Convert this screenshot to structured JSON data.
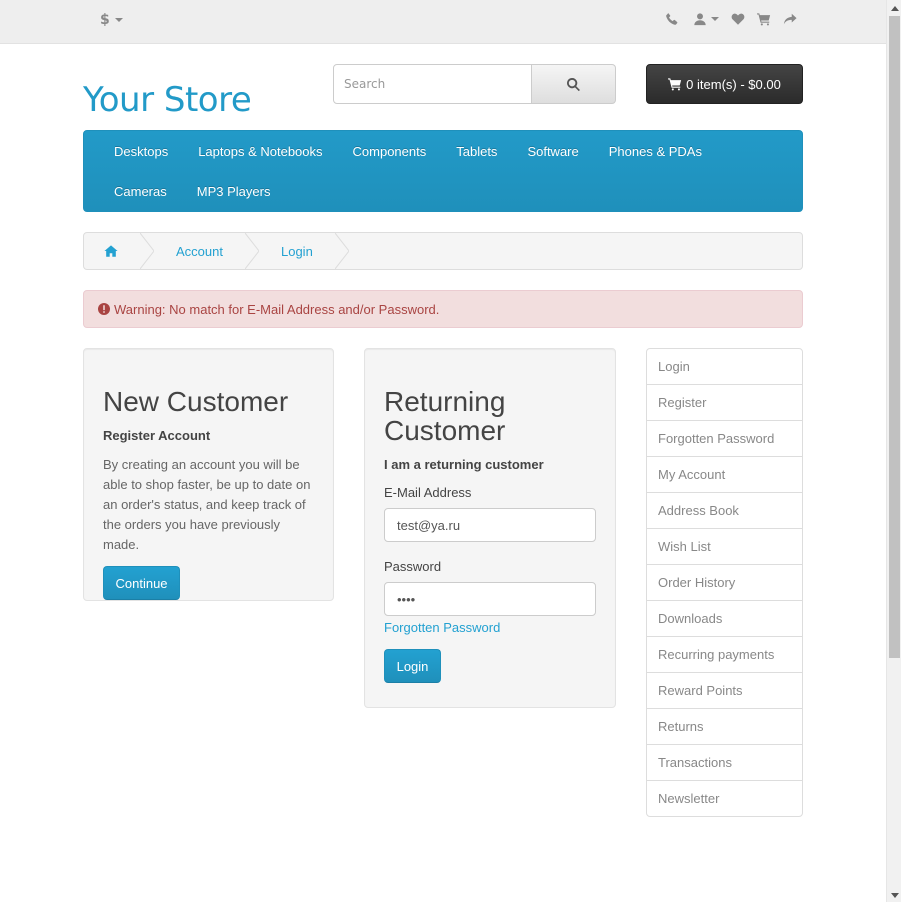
{
  "topbar": {
    "currency_symbol": "$",
    "icons": [
      "phone-icon",
      "user-icon",
      "heart-icon",
      "cart-icon",
      "share-icon"
    ]
  },
  "header": {
    "logo_text": "Your Store",
    "search_placeholder": "Search",
    "cart_label": "0 item(s) - $0.00"
  },
  "menu": {
    "items": [
      "Desktops",
      "Laptops & Notebooks",
      "Components",
      "Tablets",
      "Software",
      "Phones & PDAs",
      "Cameras",
      "MP3 Players"
    ]
  },
  "breadcrumb": {
    "items": [
      "Account",
      "Login"
    ]
  },
  "alert": {
    "text": "Warning: No match for E-Mail Address and/or Password."
  },
  "new_customer": {
    "title": "New Customer",
    "subtitle": "Register Account",
    "description": "By creating an account you will be able to shop faster, be up to date on an order's status, and keep track of the orders you have previously made.",
    "button_label": "Continue"
  },
  "returning_customer": {
    "title": "Returning Customer",
    "subtitle": "I am a returning customer",
    "email_label": "E-Mail Address",
    "email_value": "test@ya.ru",
    "password_label": "Password",
    "password_value": "••••",
    "forgot_link": "Forgotten Password",
    "button_label": "Login"
  },
  "sidebar": {
    "items": [
      "Login",
      "Register",
      "Forgotten Password",
      "My Account",
      "Address Book",
      "Wish List",
      "Order History",
      "Downloads",
      "Recurring payments",
      "Reward Points",
      "Returns",
      "Transactions",
      "Newsletter"
    ]
  },
  "colors": {
    "brand": "#229ac8",
    "alert_bg": "#f2dede",
    "alert_text": "#a94442"
  }
}
